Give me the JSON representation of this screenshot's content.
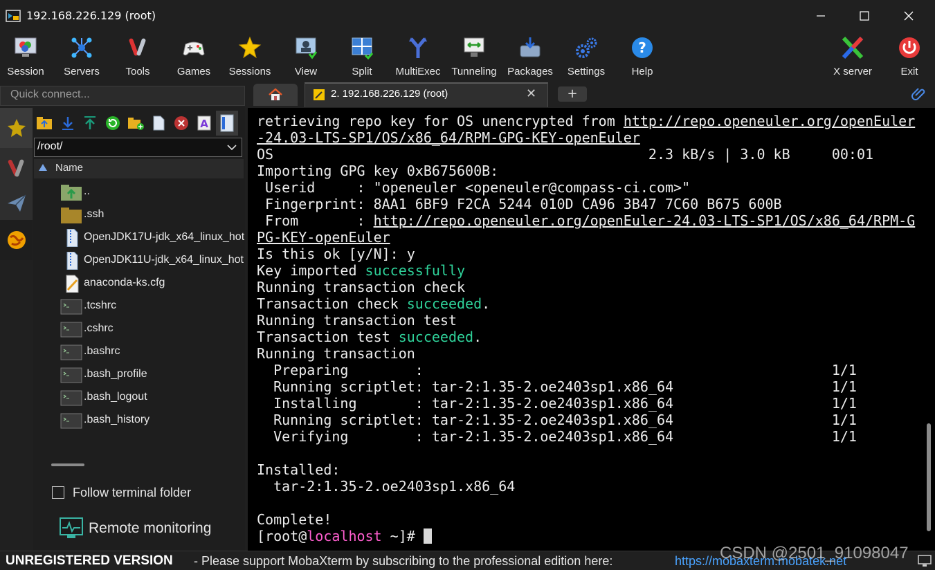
{
  "window": {
    "title": "192.168.226.129 (root)"
  },
  "toolbar": {
    "items": [
      {
        "label": "Session",
        "icon": "session-icon"
      },
      {
        "label": "Servers",
        "icon": "servers-icon"
      },
      {
        "label": "Tools",
        "icon": "tools-icon"
      },
      {
        "label": "Games",
        "icon": "gamepad-icon"
      },
      {
        "label": "Sessions",
        "icon": "star-icon"
      },
      {
        "label": "View",
        "icon": "view-icon"
      },
      {
        "label": "Split",
        "icon": "split-icon"
      },
      {
        "label": "MultiExec",
        "icon": "multiexec-icon"
      },
      {
        "label": "Tunneling",
        "icon": "tunneling-icon"
      },
      {
        "label": "Packages",
        "icon": "packages-icon"
      },
      {
        "label": "Settings",
        "icon": "gears-icon"
      },
      {
        "label": "Help",
        "icon": "help-icon"
      },
      {
        "label": "X server",
        "icon": "xserver-icon"
      },
      {
        "label": "Exit",
        "icon": "power-icon"
      }
    ]
  },
  "quick_connect": {
    "placeholder": "Quick connect..."
  },
  "tabs": {
    "session_tab": "2. 192.168.226.129 (root)",
    "new_tab": "+"
  },
  "file_browser": {
    "path": "/root/",
    "column_name": "Name",
    "files": [
      {
        "name": "..",
        "type": "parent"
      },
      {
        "name": ".ssh",
        "type": "folder"
      },
      {
        "name": "OpenJDK17U-jdk_x64_linux_hot",
        "type": "archive"
      },
      {
        "name": "OpenJDK11U-jdk_x64_linux_hot",
        "type": "archive"
      },
      {
        "name": "anaconda-ks.cfg",
        "type": "text"
      },
      {
        "name": ".tcshrc",
        "type": "shell"
      },
      {
        "name": ".cshrc",
        "type": "shell"
      },
      {
        "name": ".bashrc",
        "type": "shell"
      },
      {
        "name": ".bash_profile",
        "type": "shell"
      },
      {
        "name": ".bash_logout",
        "type": "shell"
      },
      {
        "name": ".bash_history",
        "type": "shell"
      }
    ],
    "follow_terminal_folder": "Follow terminal folder",
    "remote_monitoring": "Remote monitoring"
  },
  "terminal": {
    "lines": [
      [
        {
          "t": "retrieving repo key for OS unencrypted from "
        },
        {
          "t": "http://repo.openeuler.org/openEuler",
          "c": "ul"
        }
      ],
      [
        {
          "t": "-24.03-LTS-SP1/OS/x86_64/RPM-GPG-KEY-openEuler",
          "c": "ul"
        }
      ],
      [
        {
          "t": "OS                                             2.3 kB/s | 3.0 kB     00:01"
        }
      ],
      [
        {
          "t": "Importing GPG key 0xB675600B:"
        }
      ],
      [
        {
          "t": " Userid     : \"openeuler <openeuler@compass-ci.com>\""
        }
      ],
      [
        {
          "t": " Fingerprint: 8AA1 6BF9 F2CA 5244 010D CA96 3B47 7C60 B675 600B"
        }
      ],
      [
        {
          "t": " From       : "
        },
        {
          "t": "http://repo.openeuler.org/openEuler-24.03-LTS-SP1/OS/x86_64/RPM-G",
          "c": "ul"
        }
      ],
      [
        {
          "t": "PG-KEY-openEuler",
          "c": "ul"
        }
      ],
      [
        {
          "t": "Is this ok [y/N]: y"
        }
      ],
      [
        {
          "t": "Key imported "
        },
        {
          "t": "successfully",
          "c": "grn"
        }
      ],
      [
        {
          "t": "Running transaction check"
        }
      ],
      [
        {
          "t": "Transaction check "
        },
        {
          "t": "succeeded",
          "c": "grn"
        },
        {
          "t": "."
        }
      ],
      [
        {
          "t": "Running transaction test"
        }
      ],
      [
        {
          "t": "Transaction test "
        },
        {
          "t": "succeeded",
          "c": "grn"
        },
        {
          "t": "."
        }
      ],
      [
        {
          "t": "Running transaction"
        }
      ],
      [
        {
          "t": "  Preparing        :                                                 1/1"
        }
      ],
      [
        {
          "t": "  Running scriptlet: tar-2:1.35-2.oe2403sp1.x86_64                   1/1"
        }
      ],
      [
        {
          "t": "  Installing       : tar-2:1.35-2.oe2403sp1.x86_64                   1/1"
        }
      ],
      [
        {
          "t": "  Running scriptlet: tar-2:1.35-2.oe2403sp1.x86_64                   1/1"
        }
      ],
      [
        {
          "t": "  Verifying        : tar-2:1.35-2.oe2403sp1.x86_64                   1/1"
        }
      ],
      [
        {
          "t": ""
        }
      ],
      [
        {
          "t": "Installed:"
        }
      ],
      [
        {
          "t": "  tar-2:1.35-2.oe2403sp1.x86_64"
        }
      ],
      [
        {
          "t": ""
        }
      ],
      [
        {
          "t": "Complete!"
        }
      ],
      [
        {
          "t": "[root@"
        },
        {
          "t": "localhost",
          "c": "mag"
        },
        {
          "t": " ~]# "
        },
        {
          "t": "",
          "c": "cursor"
        }
      ]
    ]
  },
  "status": {
    "unregistered": "UNREGISTERED VERSION",
    "support_text": "-  Please support MobaXterm by subscribing to the professional edition here:",
    "support_link": "https://mobaxterm.mobatek.net",
    "watermark": "CSDN @2501_91098047"
  }
}
